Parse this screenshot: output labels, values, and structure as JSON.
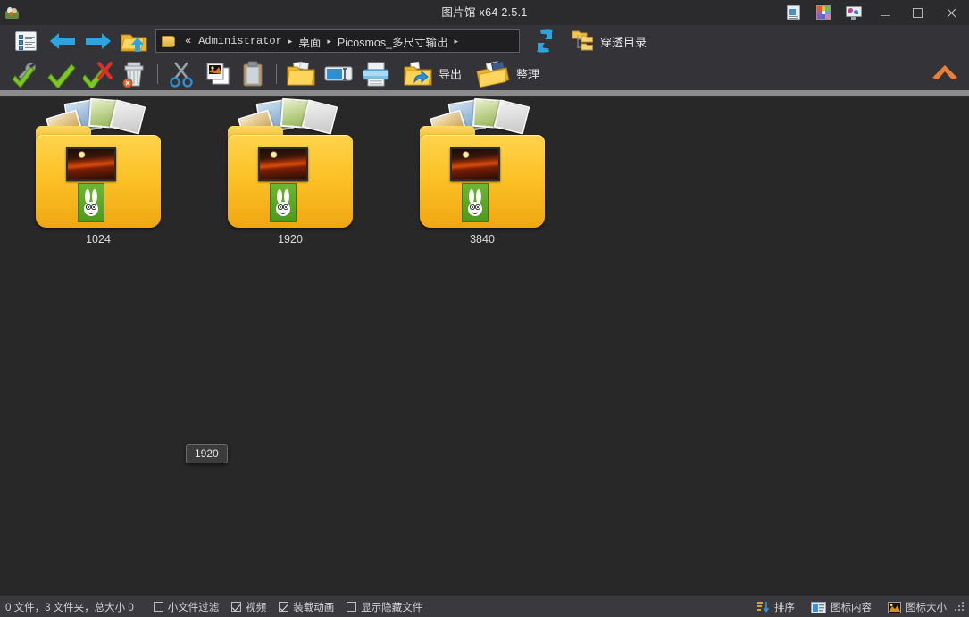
{
  "window": {
    "title": "图片馆 x64 2.5.1",
    "app_icon": "picture-gallery-icon",
    "titlebar_icons": [
      {
        "name": "document-info-icon"
      },
      {
        "name": "color-palette-icon"
      },
      {
        "name": "screen-capture-icon"
      }
    ],
    "controls": {
      "minimize": "minimize-button",
      "maximize": "maximize-button",
      "close": "close-button"
    }
  },
  "toolbar_row1": {
    "properties_label": "属性",
    "back_label": "后退",
    "forward_label": "前进",
    "up_label": "上一级",
    "path": {
      "folder_icon": "folder-icon",
      "prefix": "«",
      "crumbs": [
        "Administrator",
        "桌面",
        "Picosmos_多尺寸输出"
      ],
      "trailing_arrow": "▸"
    },
    "refresh_label": "刷新",
    "recursive_label": "穿透目录"
  },
  "toolbar_row2": {
    "buttons": [
      {
        "name": "select-tools-icon",
        "label": ""
      },
      {
        "name": "select-all-icon",
        "label": ""
      },
      {
        "name": "deselect-icon",
        "label": ""
      },
      {
        "name": "delete-icon",
        "label": ""
      },
      {
        "name": "cut-icon",
        "label": ""
      },
      {
        "name": "copy-icon",
        "label": ""
      },
      {
        "name": "paste-icon",
        "label": ""
      },
      {
        "name": "new-folder-icon",
        "label": ""
      },
      {
        "name": "rename-icon",
        "label": ""
      },
      {
        "name": "print-icon",
        "label": ""
      },
      {
        "name": "export-icon",
        "label": "导出"
      },
      {
        "name": "organize-icon",
        "label": "整理"
      }
    ],
    "export_label": "导出",
    "organize_label": "整理",
    "collapse_label": "收起工具栏"
  },
  "canvas": {
    "items": [
      {
        "label": "1024",
        "type": "folder"
      },
      {
        "label": "1920",
        "type": "folder"
      },
      {
        "label": "3840",
        "type": "folder"
      }
    ],
    "tooltip": "1920"
  },
  "statusbar": {
    "summary": "0 文件，3 文件夹，总大小 0",
    "checkboxes": [
      {
        "label": "小文件过滤",
        "checked": false
      },
      {
        "label": "视频",
        "checked": true
      },
      {
        "label": "装载动画",
        "checked": true
      },
      {
        "label": "显示隐藏文件",
        "checked": false
      }
    ],
    "right_items": [
      {
        "label": "排序",
        "icon": "sort-icon"
      },
      {
        "label": "图标内容",
        "icon": "icon-content-icon"
      },
      {
        "label": "图标大小",
        "icon": "icon-size-icon"
      }
    ]
  },
  "colors": {
    "titlebar_bg": "#2b2b2e",
    "toolbar_bg": "#343438",
    "canvas_bg": "#282828",
    "statusbar_bg": "#3a3a3e",
    "divider": "#8b8b8b",
    "accent_orange": "#e8803a",
    "arrow_blue": "#2a9ad6",
    "folder_yellow": "#fcc227",
    "text": "#d8d8d8"
  }
}
